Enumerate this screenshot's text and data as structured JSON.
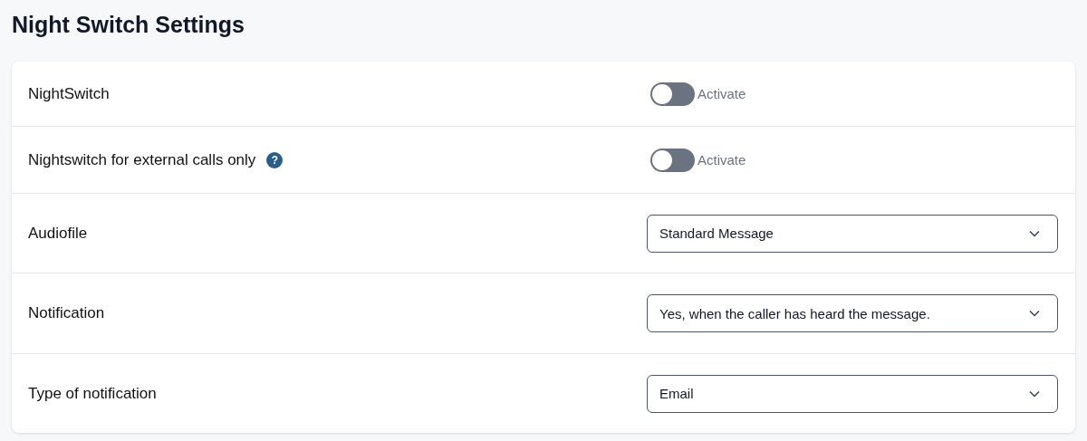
{
  "title": "Night Switch Settings",
  "settings": [
    {
      "kind": "toggle",
      "label": "NightSwitch",
      "on": false,
      "toggle_label": "Activate"
    },
    {
      "kind": "toggle",
      "label": "Nightswitch for external calls only",
      "help": "?",
      "on": false,
      "toggle_label": "Activate"
    },
    {
      "kind": "select",
      "label": "Audiofile",
      "value": "Standard Message"
    },
    {
      "kind": "select",
      "label": "Notification",
      "value": "Yes, when the caller has heard the message."
    },
    {
      "kind": "select",
      "label": "Type of notification",
      "value": "Email"
    }
  ]
}
